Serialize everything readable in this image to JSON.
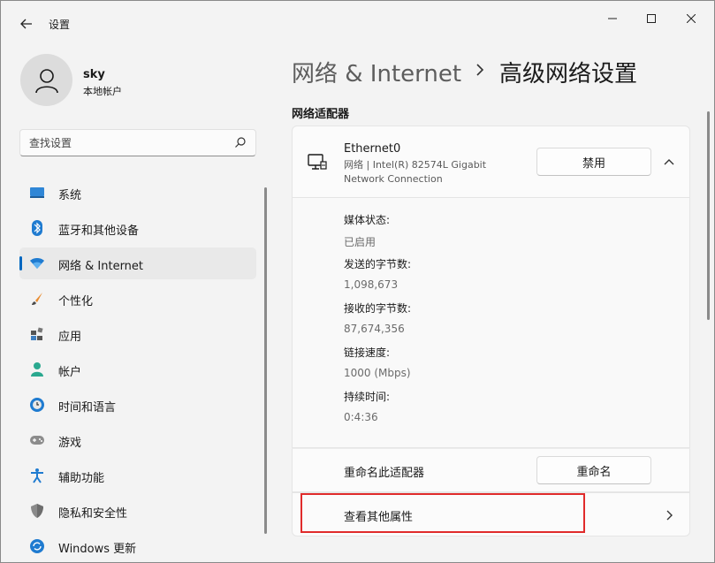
{
  "app": {
    "title": "设置"
  },
  "profile": {
    "name": "sky",
    "account_type": "本地帐户"
  },
  "search": {
    "placeholder": "查找设置"
  },
  "sidebar": {
    "items": [
      {
        "label": "系统",
        "icon": "system-icon"
      },
      {
        "label": "蓝牙和其他设备",
        "icon": "bluetooth-icon"
      },
      {
        "label": "网络 & Internet",
        "icon": "wifi-icon",
        "active": true
      },
      {
        "label": "个性化",
        "icon": "brush-icon"
      },
      {
        "label": "应用",
        "icon": "apps-icon"
      },
      {
        "label": "帐户",
        "icon": "person-icon"
      },
      {
        "label": "时间和语言",
        "icon": "clock-globe-icon"
      },
      {
        "label": "游戏",
        "icon": "gamepad-icon"
      },
      {
        "label": "辅助功能",
        "icon": "accessibility-icon"
      },
      {
        "label": "隐私和安全性",
        "icon": "shield-icon"
      },
      {
        "label": "Windows 更新",
        "icon": "update-icon"
      }
    ]
  },
  "breadcrumb": {
    "parent": "网络 & Internet",
    "current": "高级网络设置"
  },
  "section": {
    "title": "网络适配器"
  },
  "adapter": {
    "name": "Ethernet0",
    "description": "网络 | Intel(R) 82574L Gigabit Network Connection",
    "disable_label": "禁用"
  },
  "details": [
    {
      "label": "媒体状态:",
      "value": "已启用"
    },
    {
      "label": "发送的字节数:",
      "value": "1,098,673"
    },
    {
      "label": "接收的字节数:",
      "value": "87,674,356"
    },
    {
      "label": "链接速度:",
      "value": "1000 (Mbps)"
    },
    {
      "label": "持续时间:",
      "value": "0:4:36"
    }
  ],
  "rename": {
    "label": "重命名此适配器",
    "button_label": "重命名"
  },
  "properties": {
    "label": "查看其他属性"
  },
  "colors": {
    "accent": "#0067c0",
    "highlight": "#e02b2b"
  }
}
